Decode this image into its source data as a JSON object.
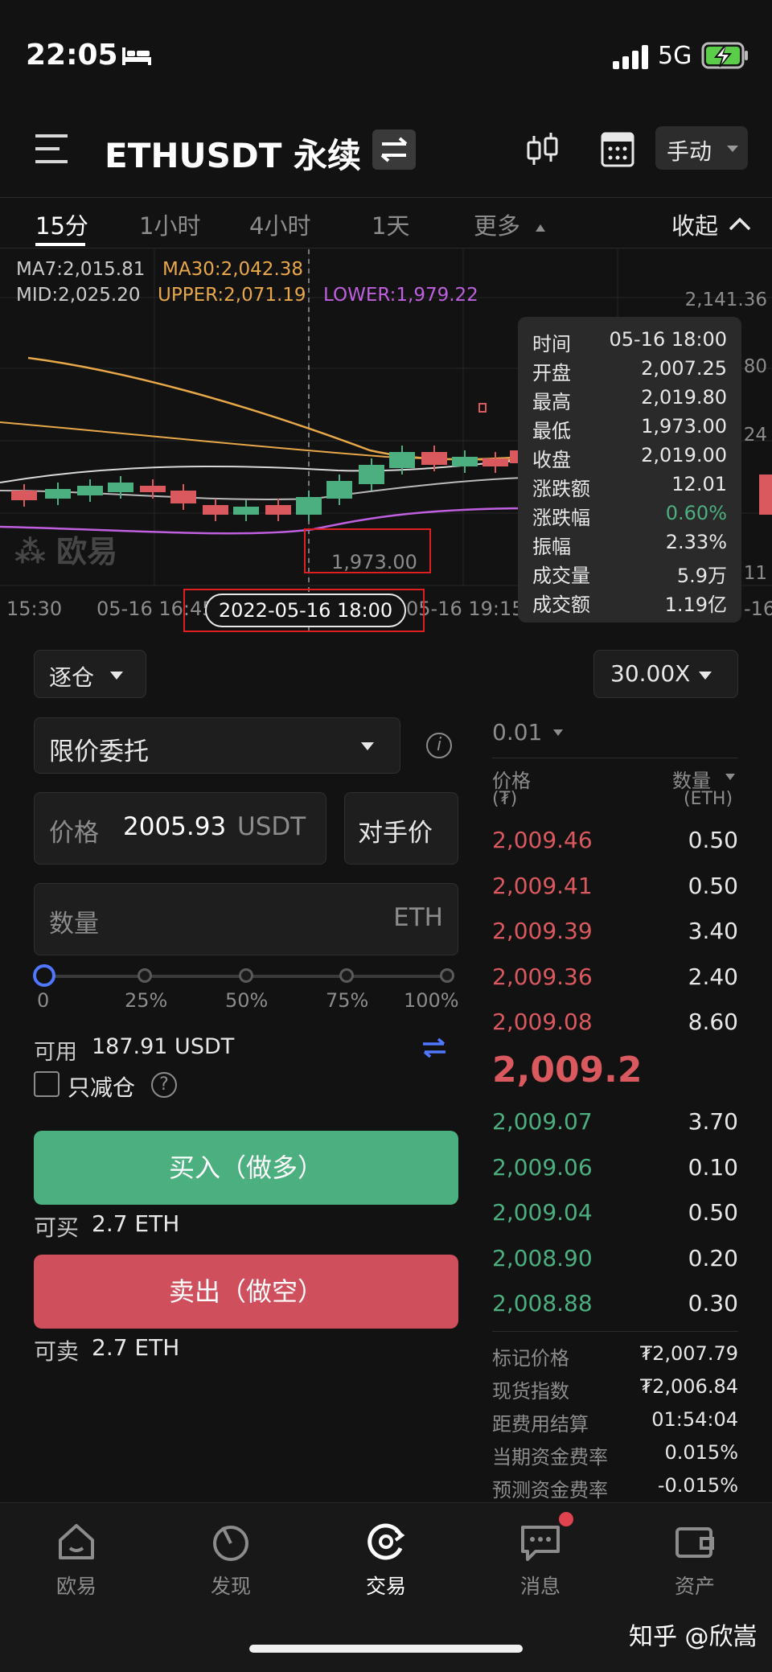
{
  "status": {
    "time": "22:05",
    "network": "5G",
    "icons": [
      "bed-icon",
      "signal-icon",
      "battery-charging-icon"
    ]
  },
  "nav": {
    "title": "ETHUSDT 永续",
    "mode": "手动",
    "icons": [
      "menu-icon",
      "swap-icon",
      "candlestick-icon",
      "calculator-icon"
    ]
  },
  "tabs": {
    "items": [
      "15分",
      "1小时",
      "4小时",
      "1天",
      "更多"
    ],
    "active": "15分",
    "collapse": "收起"
  },
  "indicators": {
    "ma7": "MA7:2,015.81",
    "ma30": "MA30:2,042.38",
    "mid": "MID:2,025.20",
    "upper": "UPPER:2,071.19",
    "lower": "LOWER:1,979.22",
    "colors": {
      "ma7": "#cccccc",
      "ma30": "#e8a84a",
      "upper": "#e8a84a",
      "lower": "#c060e0",
      "mid": "#cccccc"
    }
  },
  "chart": {
    "price_axis": [
      "2,141.36",
      "80",
      "24",
      "11"
    ],
    "watermark": "欧易",
    "low_marker": "1,973.00",
    "crosshair_date": "2022-05-16 18:00",
    "time_ticks": [
      "15:30",
      "05-16 16:45",
      "05-16 19:15",
      "-16"
    ],
    "up_color": "#4caf7f",
    "down_color": "#d9595f"
  },
  "tooltip": {
    "rows": [
      {
        "label": "时间",
        "value": "05-16 18:00"
      },
      {
        "label": "开盘",
        "value": "2,007.25"
      },
      {
        "label": "最高",
        "value": "2,019.80"
      },
      {
        "label": "最低",
        "value": "1,973.00"
      },
      {
        "label": "收盘",
        "value": "2,019.00"
      },
      {
        "label": "涨跌额",
        "value": "12.01"
      },
      {
        "label": "涨跌幅",
        "value": "0.60%"
      },
      {
        "label": "振幅",
        "value": "2.33%"
      },
      {
        "label": "成交量",
        "value": "5.9万"
      },
      {
        "label": "成交额",
        "value": "1.19亿"
      }
    ]
  },
  "order": {
    "margin_mode": "逐仓",
    "leverage": "30.00X",
    "order_type": "限价委托",
    "price_label": "价格",
    "price_value": "2005.93",
    "price_unit": "USDT",
    "counterparty_button": "对手价",
    "qty_placeholder": "数量",
    "qty_unit": "ETH",
    "slider_labels": [
      "0",
      "25%",
      "50%",
      "75%",
      "100%"
    ],
    "slider_value": 0,
    "available_label": "可用",
    "available_value": "187.91 USDT",
    "reduce_only": "只减仓",
    "buy_label": "买入（做多）",
    "can_buy_label": "可买",
    "can_buy_value": "2.7 ETH",
    "sell_label": "卖出（做空）",
    "can_sell_label": "可卖",
    "can_sell_value": "2.7 ETH"
  },
  "orderbook": {
    "precision": "0.01",
    "price_header": "价格",
    "price_unit": "(₮)",
    "qty_header": "数量",
    "qty_unit": "(ETH)",
    "asks": [
      {
        "price": "2,009.46",
        "qty": "0.50"
      },
      {
        "price": "2,009.41",
        "qty": "0.50"
      },
      {
        "price": "2,009.39",
        "qty": "3.40"
      },
      {
        "price": "2,009.36",
        "qty": "2.40"
      },
      {
        "price": "2,009.08",
        "qty": "8.60"
      }
    ],
    "last_price": "2,009.2",
    "bids": [
      {
        "price": "2,009.07",
        "qty": "3.70"
      },
      {
        "price": "2,009.06",
        "qty": "0.10"
      },
      {
        "price": "2,009.04",
        "qty": "0.50"
      },
      {
        "price": "2,008.90",
        "qty": "0.20"
      },
      {
        "price": "2,008.88",
        "qty": "0.30"
      }
    ],
    "info": [
      {
        "label": "标记价格",
        "value": "₮2,007.79"
      },
      {
        "label": "现货指数",
        "value": "₮2,006.84"
      },
      {
        "label": "距费用结算",
        "value": "01:54:04"
      },
      {
        "label": "当期资金费率",
        "value": "0.015%"
      },
      {
        "label": "预测资金费率",
        "value": "-0.015%"
      }
    ]
  },
  "bottom_nav": {
    "items": [
      "欧易",
      "发现",
      "交易",
      "消息",
      "资产"
    ],
    "active": "交易"
  },
  "watermark_footer": "知乎 @欣嵩"
}
